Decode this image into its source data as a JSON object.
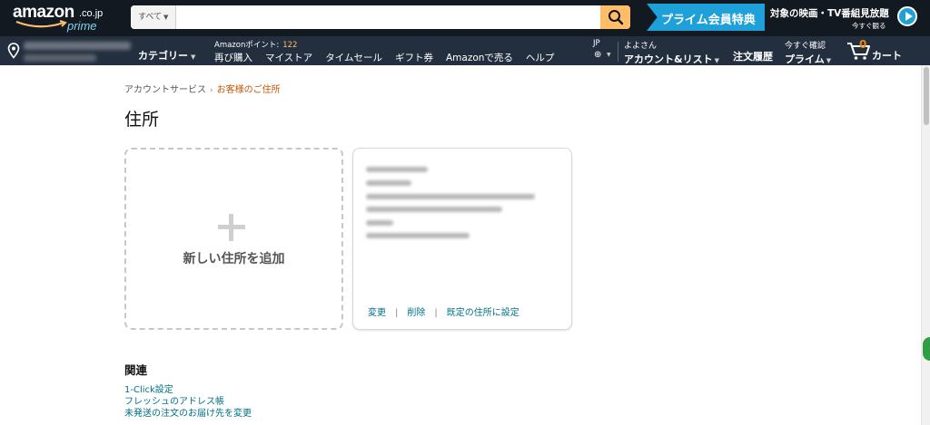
{
  "header": {
    "logo_word": "amazon",
    "logo_tld": ".co.jp",
    "logo_prime": "prime",
    "search": {
      "category": "すべて",
      "value": "",
      "placeholder": ""
    },
    "prime_banner": "プライム会員特典",
    "video_promo": {
      "title": "対象の映画・TV番組見放題",
      "subtitle": "今すぐ観る"
    }
  },
  "nav": {
    "category": "カテゴリー",
    "points_label": "Amazonポイント:",
    "points_value": "122",
    "links": [
      "再び購入",
      "マイストア",
      "タイムセール",
      "ギフト券",
      "Amazonで売る",
      "ヘルプ"
    ],
    "lang": "JP",
    "account_hello": "よよさん",
    "account_label": "アカウント&リスト",
    "orders": "注文履歴",
    "prime_small": "今すぐ確認",
    "prime_big": "プライム",
    "cart_count": "0",
    "cart_label": "カート"
  },
  "breadcrumb": {
    "parent": "アカウントサービス",
    "separator": "›",
    "current": "お客様のご住所"
  },
  "page_title": "住所",
  "add_address_label": "新しい住所を追加",
  "address_card": {
    "actions": {
      "edit": "変更",
      "delete": "削除",
      "set_default": "既定の住所に設定",
      "separator": "|"
    }
  },
  "related": {
    "heading": "関連",
    "links": [
      "1-Click設定",
      "フレッシュのアドレス帳",
      "未発送の注文のお届け先を変更"
    ]
  },
  "colors": {
    "topbar": "#131921",
    "navbar": "#232f3e",
    "search_button": "#febd69",
    "prime_blue": "#1ea0d8",
    "link": "#007185",
    "breadcrumb_current": "#c45500",
    "cart_count": "#f08804"
  },
  "icons": [
    "location-pin-icon",
    "search-icon",
    "globe-icon",
    "cart-icon",
    "play-icon",
    "plus-icon"
  ]
}
